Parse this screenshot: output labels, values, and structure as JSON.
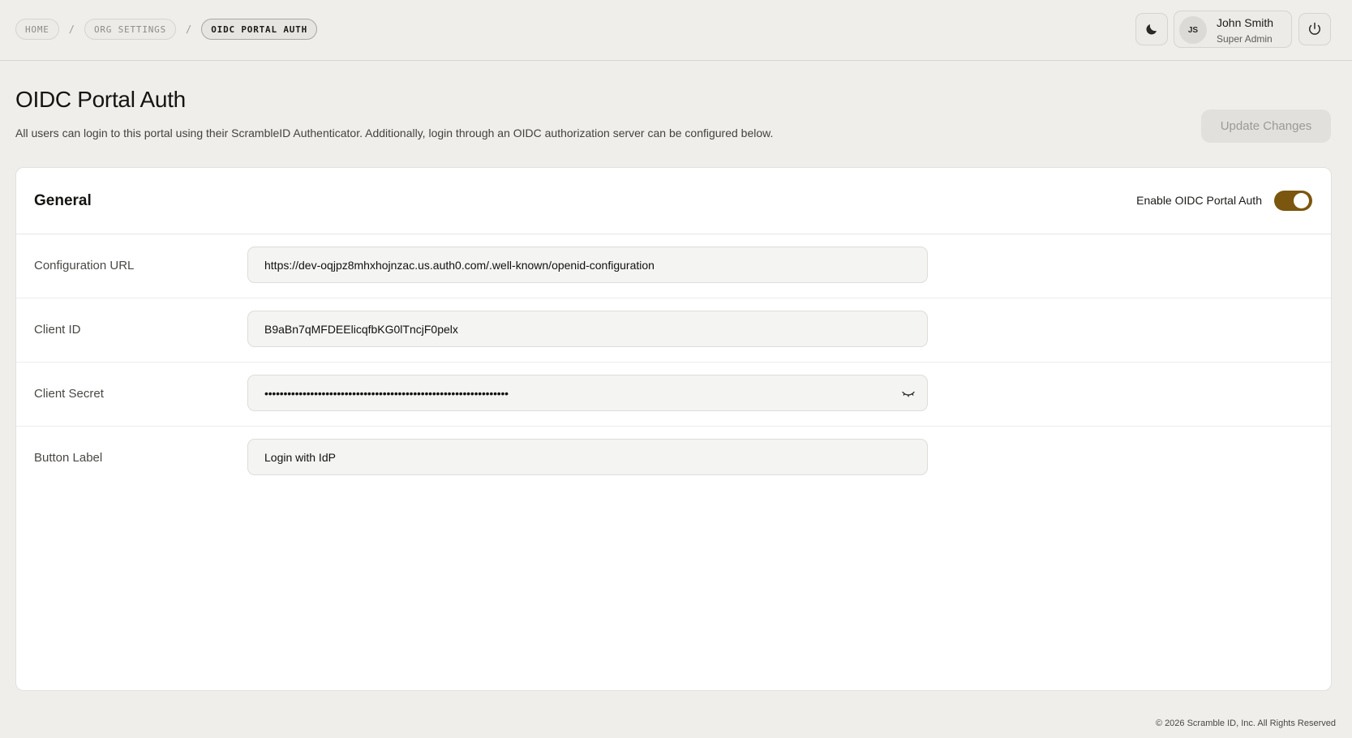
{
  "breadcrumb": {
    "items": [
      "HOME",
      "ORG SETTINGS",
      "OIDC PORTAL AUTH"
    ],
    "separator": "/"
  },
  "header_controls": {
    "theme_icon": "moon-icon",
    "power_icon": "power-icon"
  },
  "user": {
    "initials": "JS",
    "name": "John Smith",
    "role": "Super Admin"
  },
  "page": {
    "title": "OIDC Portal Auth",
    "description": "All users can login to this portal using their ScrambleID Authenticator. Additionally, login through an OIDC authorization server can be configured below.",
    "update_button": "Update Changes"
  },
  "card": {
    "title": "General",
    "toggle_label": "Enable OIDC Portal Auth",
    "toggle_on": true,
    "accent_color": "#7b560e",
    "fields": [
      {
        "label": "Configuration URL",
        "value": "https://dev-oqjpz8mhxhojnzac.us.auth0.com/.well-known/openid-configuration"
      },
      {
        "label": "Client ID",
        "value": "B9aBn7qMFDEElicqfbKG0lTncjF0pelx"
      },
      {
        "label": "Client Secret",
        "value": "••••••••••••••••••••••••••••••••••••••••••••••••••••••••••••••••",
        "masked": true,
        "reveal_icon": "eye-closed-icon"
      },
      {
        "label": "Button Label",
        "value": "Login with IdP"
      }
    ]
  },
  "footer": {
    "copyright": "© 2026 Scramble ID, Inc. All Rights Reserved"
  }
}
